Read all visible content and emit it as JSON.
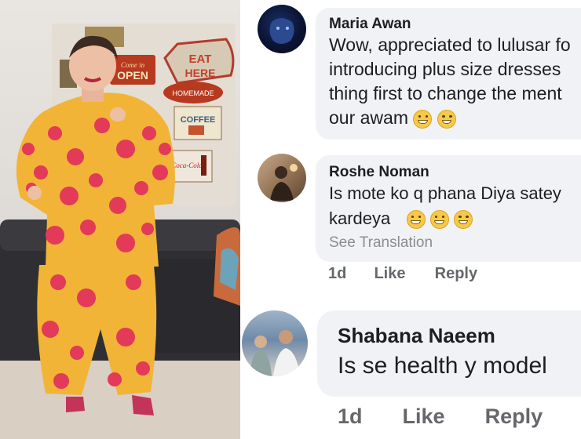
{
  "photo": {
    "description_icon": "woman-photo",
    "signs": [
      "Come in OPEN",
      "EAT HERE",
      "Homemade",
      "COFFEE",
      "Coca-Cola"
    ]
  },
  "comments": [
    {
      "name": "Maria Awan",
      "lines": [
        "Wow, appreciated to lulusar fo",
        "introducing plus size dresses",
        "thing first to change the ment",
        "our awam"
      ],
      "emoji": "grinning-emoji"
    },
    {
      "name": "Roshe Noman",
      "lines": [
        "Is mote ko q phana Diya satey",
        "kardeya"
      ],
      "emoji": "laughing-emoji",
      "see_translation": "See Translation",
      "time": "1d",
      "like": "Like",
      "reply": "Reply"
    },
    {
      "name": "Shabana Naeem",
      "lines": [
        "Is se health y model"
      ],
      "time": "1d",
      "like": "Like",
      "reply": "Reply"
    }
  ],
  "colors": {
    "bubble": "#f0f2f5",
    "muted": "#65676b",
    "text": "#1c1e21"
  }
}
